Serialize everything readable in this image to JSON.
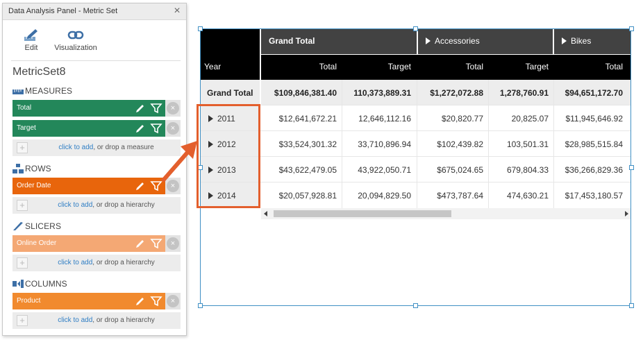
{
  "panel": {
    "title": "Data Analysis Panel - Metric Set",
    "close_glyph": "×",
    "toolbar": {
      "edit_label": "Edit",
      "visualization_label": "Visualization"
    },
    "metricset_name": "MetricSet8",
    "sections": {
      "measures": {
        "heading": "MEASURES",
        "icon": "ruler-icon",
        "items": [
          {
            "label": "Total",
            "color": "#23875a"
          },
          {
            "label": "Target",
            "color": "#23875a"
          }
        ],
        "drop_link": "click to add",
        "drop_text": ", or drop a measure"
      },
      "rows": {
        "heading": "ROWS",
        "icon": "hierarchy-icon",
        "items": [
          {
            "label": "Order Date",
            "color": "#e8650c"
          }
        ],
        "drop_link": "click to add",
        "drop_text": ", or drop a hierarchy"
      },
      "slicers": {
        "heading": "SLICERS",
        "icon": "slicer-knife-icon",
        "items": [
          {
            "label": "Online Order",
            "color": "#f4a874"
          }
        ],
        "drop_link": "click to add",
        "drop_text": ", or drop a hierarchy"
      },
      "columns": {
        "heading": "COLUMNS",
        "icon": "columns-icon",
        "items": [
          {
            "label": "Product",
            "color": "#f18a2e"
          }
        ],
        "drop_link": "click to add",
        "drop_text": ", or drop a hierarchy"
      }
    }
  },
  "pivot": {
    "row_header_label": "Year",
    "column_groups": [
      {
        "label": "Grand Total",
        "expandable": false
      },
      {
        "label": "Accessories",
        "expandable": true
      },
      {
        "label": "Bikes",
        "expandable": true
      }
    ],
    "measure_headers": [
      "Total",
      "Target",
      "Total",
      "Target",
      "Total"
    ],
    "grand_total_row": {
      "label": "Grand Total",
      "values": [
        "$109,846,381.40",
        "110,373,889.31",
        "$1,272,072.88",
        "1,278,760.91",
        "$94,651,172.70"
      ]
    },
    "rows": [
      {
        "label": "2011",
        "values": [
          "$12,641,672.21",
          "12,646,112.16",
          "$20,820.77",
          "20,825.07",
          "$11,945,646.92"
        ]
      },
      {
        "label": "2012",
        "values": [
          "$33,524,301.32",
          "33,710,896.94",
          "$102,439.82",
          "103,501.31",
          "$28,985,515.84"
        ]
      },
      {
        "label": "2013",
        "values": [
          "$43,622,479.05",
          "43,922,050.71",
          "$675,024.65",
          "679,804.33",
          "$36,266,829.36"
        ]
      },
      {
        "label": "2014",
        "values": [
          "$20,057,928.81",
          "20,094,829.50",
          "$473,787.64",
          "474,630.21",
          "$17,453,180.57"
        ]
      }
    ]
  },
  "colors": {
    "header_black": "#000000",
    "header_group": "#424242",
    "highlight": "#e35f2d",
    "selection": "#3f8fc4"
  }
}
